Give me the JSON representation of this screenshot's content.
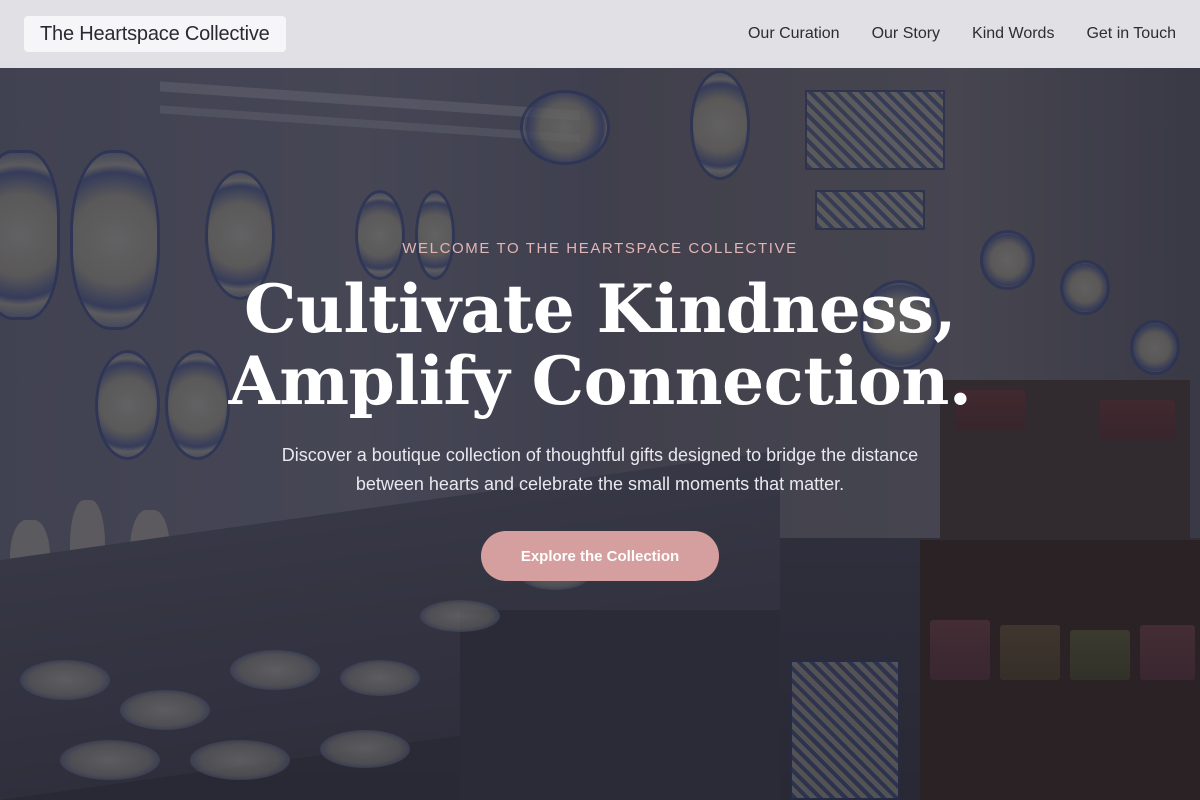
{
  "brand": {
    "name": "The Heartspace Collective"
  },
  "nav": {
    "items": [
      {
        "label": "Our Curation"
      },
      {
        "label": "Our Story"
      },
      {
        "label": "Kind Words"
      },
      {
        "label": "Get in Touch"
      }
    ]
  },
  "hero": {
    "eyebrow": "WELCOME TO THE HEARTSPACE COLLECTIVE",
    "headline_line1": "Cultivate Kindness,",
    "headline_line2": "Amplify Connection.",
    "subtext": "Discover a boutique collection of thoughtful gifts designed to bridge the distance between hearts and celebrate the small moments that matter.",
    "cta_label": "Explore the Collection"
  },
  "colors": {
    "accent": "#d69f9f",
    "eyebrow": "#e4b5b5",
    "navbar_bg": "#eeeef2"
  }
}
